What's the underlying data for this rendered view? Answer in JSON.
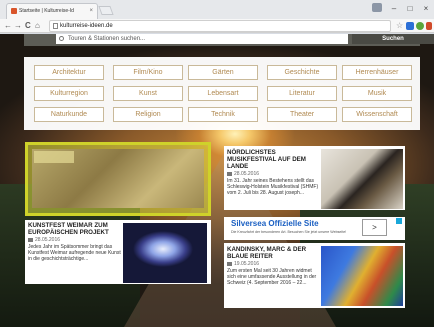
{
  "browser": {
    "tab_title": "Startseite | Kulturreise-Id",
    "tab_close": "×",
    "url": "kulturreise-ideen.de",
    "minimize": "–",
    "maximize": "□",
    "close": "×",
    "back": "←",
    "forward": "→",
    "reload": "C",
    "home": "⌂",
    "star": "☆"
  },
  "search": {
    "placeholder": "Touren & Stationen suchen...",
    "button_label": "Suchen"
  },
  "categories": [
    "Architektur",
    "Film/Kino",
    "Gärten",
    "Geschichte",
    "Herrenhäuser",
    "Kulturregion",
    "Kunst",
    "Lebensart",
    "Literatur",
    "Musik",
    "Naturkunde",
    "Religion",
    "Technik",
    "Theater",
    "Wissenschaft"
  ],
  "articles": {
    "musikfestival": {
      "title": "Nördlichstes Musikfestival auf dem Lande",
      "date": "28.05.2016",
      "text": "Im 31. Jahr seines Bestehens stellt das Schleswig-Holstein Musikfestival (SHMF) vom 2. Juli bis 28. August joseph..."
    },
    "weimar": {
      "title": "Kunstfest Weimar zum europäischen Projekt",
      "date": "28.05.2016",
      "text": "Jedes Jahr im Spätsommer bringt das Kunstfest Weimar aufregende neue Kunst in die geschichtsträchtige..."
    },
    "kandinsky": {
      "title": "Kandinsky, Marc & Der Blaue Reiter",
      "date": "19.05.2016",
      "text": "Zum ersten Mal seit 30 Jahren widmet sich eine umfassende Ausstellung in der Schweiz (4. September 2016 – 22..."
    }
  },
  "ad": {
    "title": "Silversea Offizielle Site",
    "subtitle": "Die Kreuzfahrt der besonderen Art. Besuchen Sie jetzt unsere Webseite!",
    "arrow": ">"
  },
  "colors": {
    "accent_gold": "#b08a52",
    "hero_yellow": "#cfd22a",
    "ad_blue": "#1a5fc2"
  }
}
